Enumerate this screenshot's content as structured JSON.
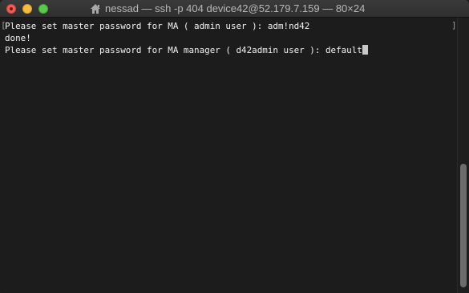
{
  "window": {
    "title": "nessad — ssh -p 404 device42@52.179.7.159 — 80×24"
  },
  "terminal": {
    "lines": [
      "Please set master password for MA ( admin user ): adm!nd42",
      "done!",
      "Please set master password for MA manager ( d42admin user ): default"
    ]
  },
  "icons": {
    "title_icon": "home-icon",
    "close": "close-icon",
    "minimize": "minimize-icon",
    "maximize": "maximize-icon"
  },
  "colors": {
    "background": "#1c1c1c",
    "text": "#f0f0f0",
    "titlebar": "#333333",
    "close": "#ee5f58",
    "minimize": "#f5bd3f",
    "maximize": "#5cc74d"
  }
}
